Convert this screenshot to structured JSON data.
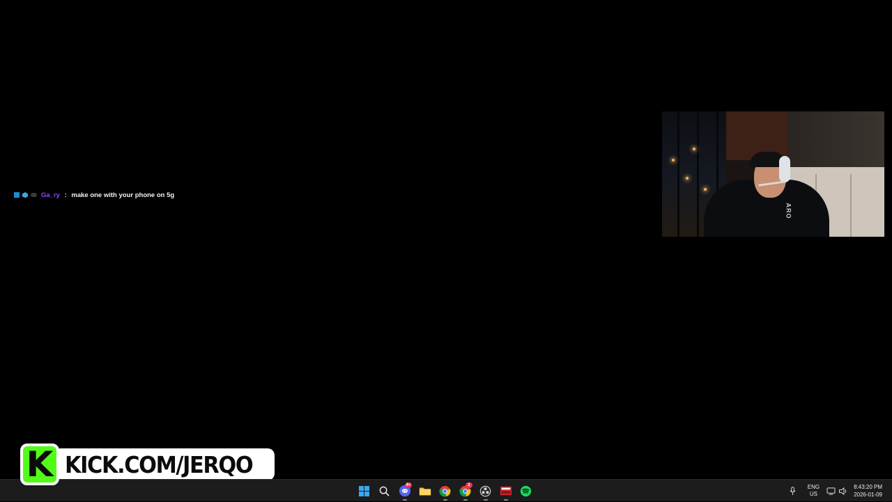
{
  "chat": {
    "username": "Ga_ry",
    "separator": " : ",
    "message": "make one with your phone on 5g"
  },
  "webcam": {
    "shirt_text": "ARO"
  },
  "branding": {
    "logo_letter": "K",
    "url": "KICK.COM/JERQO",
    "accent_color": "#53fc18"
  },
  "taskbar": {
    "apps": [
      {
        "name": "start",
        "icon": "windows-icon"
      },
      {
        "name": "search",
        "icon": "search-icon"
      },
      {
        "name": "discord",
        "icon": "discord-icon",
        "badge": "4+"
      },
      {
        "name": "file-explorer",
        "icon": "folder-icon"
      },
      {
        "name": "chrome",
        "icon": "chrome-icon"
      },
      {
        "name": "chrome-2",
        "icon": "chrome-icon",
        "badge": "2"
      },
      {
        "name": "obs",
        "icon": "obs-icon"
      },
      {
        "name": "voicemeeter",
        "icon": "voicemeeter-icon"
      },
      {
        "name": "spotify",
        "icon": "spotify-icon"
      }
    ],
    "tray": {
      "lang_top": "ENG",
      "lang_bottom": "US",
      "time": "8:43:20 PM",
      "date": "2026-01-09"
    }
  }
}
